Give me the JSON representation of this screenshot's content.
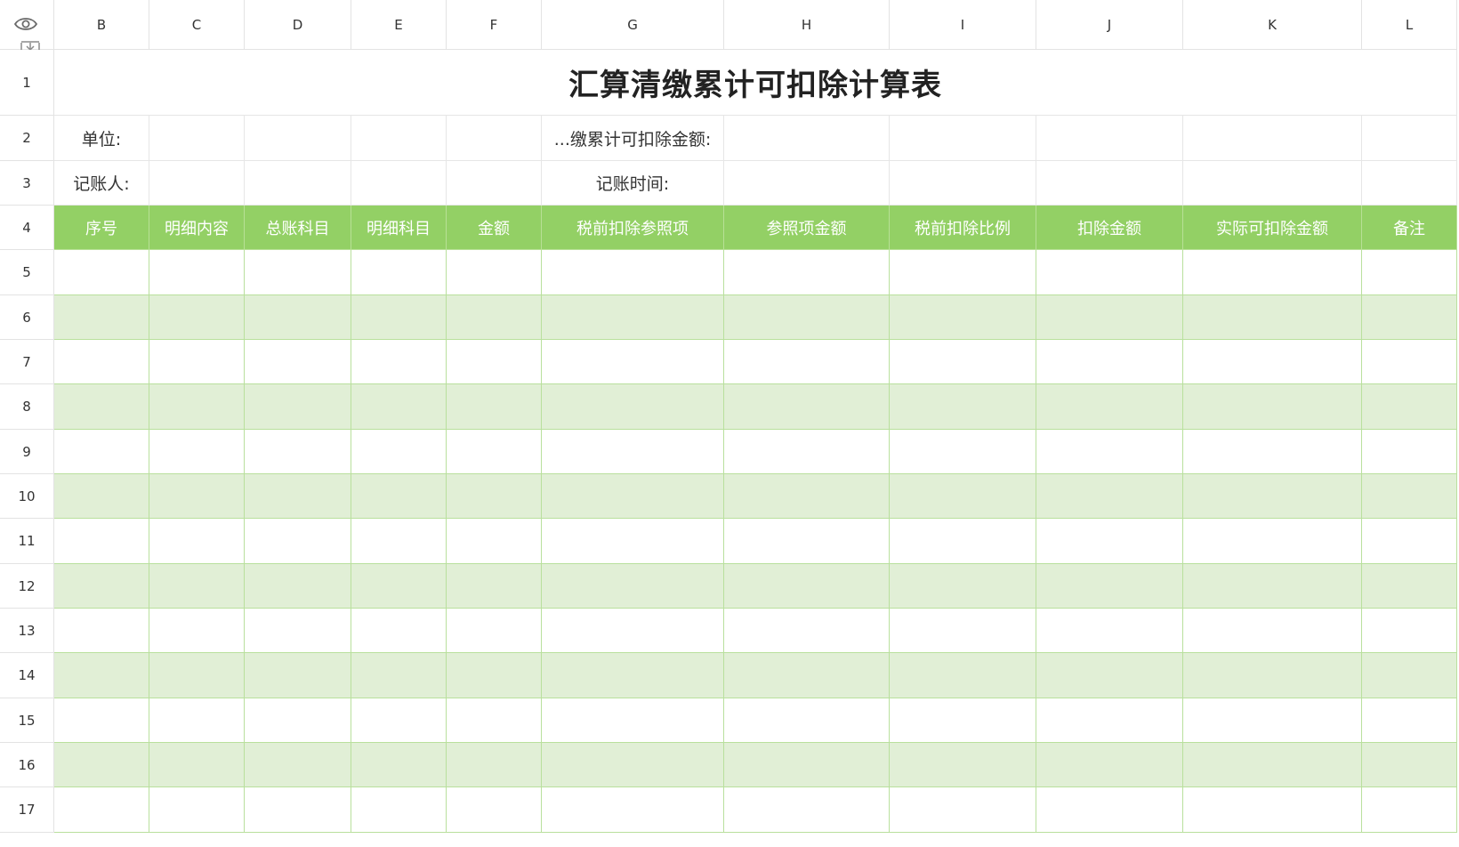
{
  "columns": [
    "B",
    "C",
    "D",
    "E",
    "F",
    "G",
    "H",
    "I",
    "J",
    "K",
    "L"
  ],
  "rows": [
    "1",
    "2",
    "3",
    "4",
    "5",
    "6",
    "7",
    "8",
    "9",
    "10",
    "11",
    "12",
    "13",
    "14",
    "15",
    "16",
    "17"
  ],
  "sheet": {
    "title": "汇算清缴累计可扣除计算表",
    "unit_label": "单位:",
    "deductible_label": "...缴累计可扣除金额:",
    "bookkeeper_label": "记账人:",
    "bookkeeping_time_label": "记账时间:",
    "headers": [
      "序号",
      "明细内容",
      "总账科目",
      "明细科目",
      "金额",
      "税前扣除参照项",
      "参照项金额",
      "税前扣除比例",
      "扣除金额",
      "实际可扣除金额",
      "备注"
    ]
  },
  "icons": {
    "visibility": "eye-icon",
    "freeze": "freeze-rows-icon"
  },
  "colors": {
    "header_fill": "#93d065",
    "band_fill": "#e1efd6",
    "grid_line": "#b9e09d"
  }
}
